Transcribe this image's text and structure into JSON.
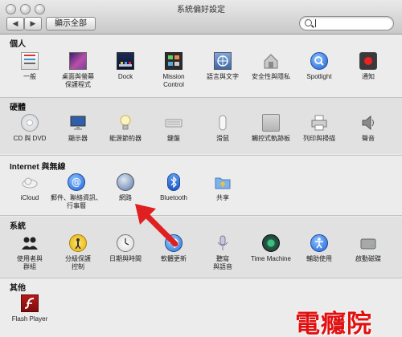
{
  "window": {
    "title": "系統偏好設定"
  },
  "toolbar": {
    "back": "◀",
    "forward": "▶",
    "show_all": "顯示全部"
  },
  "search": {
    "placeholder": ""
  },
  "sections": [
    {
      "title": "個人",
      "items": [
        {
          "label": "一般",
          "icon": "general-icon"
        },
        {
          "label": "桌面與螢幕\n保護程式",
          "icon": "desktop-screensaver-icon"
        },
        {
          "label": "Dock",
          "icon": "dock-icon"
        },
        {
          "label": "Mission\nControl",
          "icon": "mission-control-icon"
        },
        {
          "label": "語言與文字",
          "icon": "language-text-icon"
        },
        {
          "label": "安全性與隱私",
          "icon": "security-privacy-icon"
        },
        {
          "label": "Spotlight",
          "icon": "spotlight-icon"
        },
        {
          "label": "通知",
          "icon": "notifications-icon"
        }
      ]
    },
    {
      "title": "硬體",
      "items": [
        {
          "label": "CD 與 DVD",
          "icon": "cd-dvd-icon"
        },
        {
          "label": "顯示器",
          "icon": "displays-icon"
        },
        {
          "label": "能源節約器",
          "icon": "energy-saver-icon"
        },
        {
          "label": "鍵盤",
          "icon": "keyboard-icon"
        },
        {
          "label": "滑鼠",
          "icon": "mouse-icon"
        },
        {
          "label": "觸控式軌跡板",
          "icon": "trackpad-icon"
        },
        {
          "label": "列印與掃描",
          "icon": "print-scan-icon"
        },
        {
          "label": "聲音",
          "icon": "sound-icon"
        }
      ]
    },
    {
      "title": "Internet 與無線",
      "items": [
        {
          "label": "iCloud",
          "icon": "icloud-icon"
        },
        {
          "label": "郵件、聯絡資訊、\n行事曆",
          "icon": "mail-contacts-calendars-icon"
        },
        {
          "label": "網路",
          "icon": "network-icon"
        },
        {
          "label": "Bluetooth",
          "icon": "bluetooth-icon"
        },
        {
          "label": "共享",
          "icon": "sharing-icon"
        }
      ]
    },
    {
      "title": "系統",
      "items": [
        {
          "label": "使用者與\n群組",
          "icon": "users-groups-icon"
        },
        {
          "label": "分級保護\n控制",
          "icon": "parental-controls-icon"
        },
        {
          "label": "日期與時間",
          "icon": "date-time-icon"
        },
        {
          "label": "軟體更新",
          "icon": "software-update-icon"
        },
        {
          "label": "聽寫\n與語音",
          "icon": "dictation-speech-icon"
        },
        {
          "label": "Time Machine",
          "icon": "time-machine-icon"
        },
        {
          "label": "輔助使用",
          "icon": "accessibility-icon"
        },
        {
          "label": "啟動磁碟",
          "icon": "startup-disk-icon"
        }
      ]
    },
    {
      "title": "其他",
      "items": [
        {
          "label": "Flash Player",
          "icon": "flash-player-icon"
        }
      ]
    }
  ],
  "watermark": "電癮院"
}
